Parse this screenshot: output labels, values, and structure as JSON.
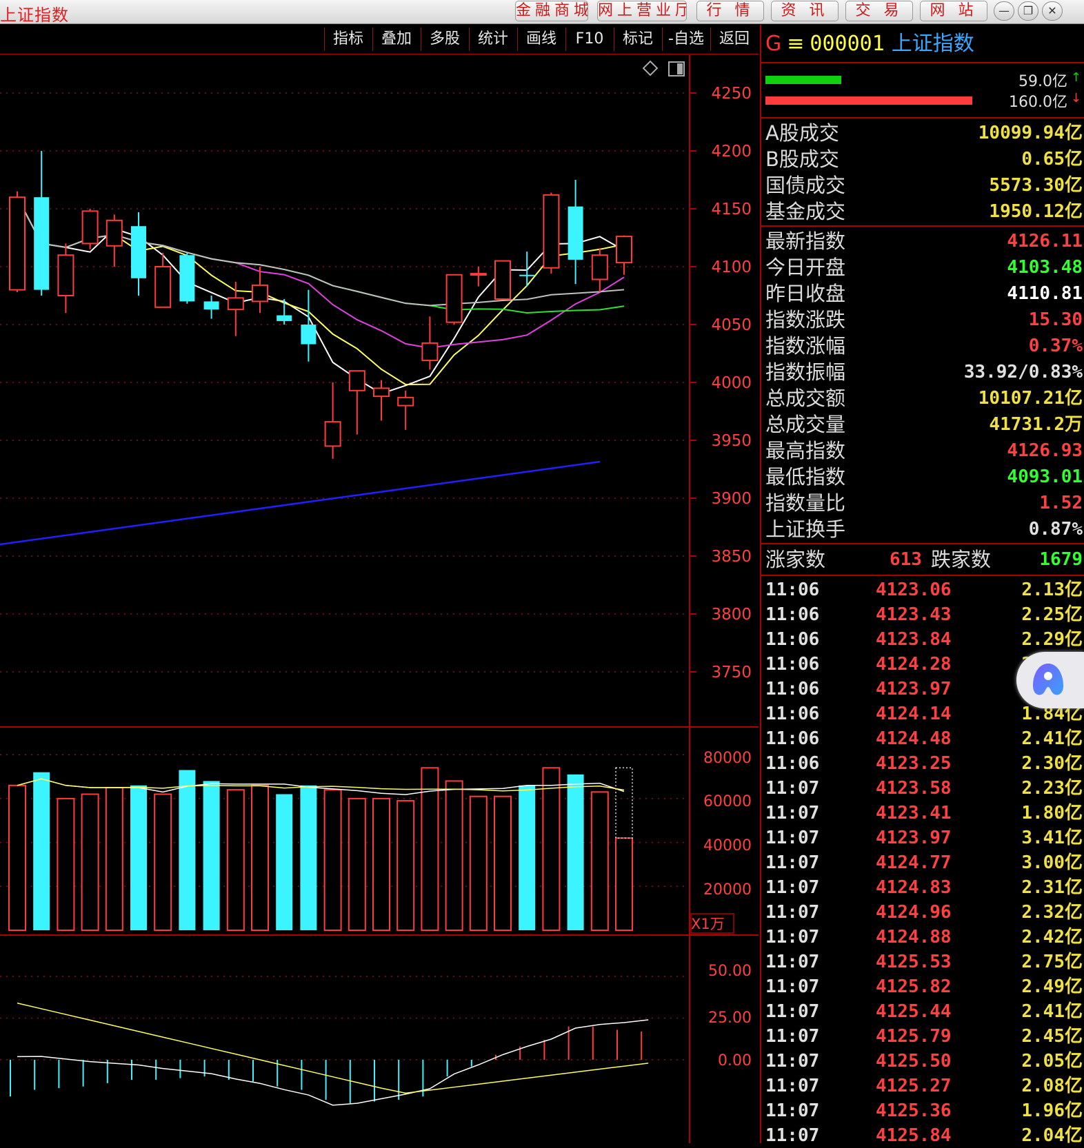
{
  "window": {
    "title": "上证指数",
    "nav": [
      "金融商城",
      "网上营业厅",
      "行 情",
      "资 讯",
      "交 易",
      "网 站"
    ],
    "controls": [
      "—",
      "❐",
      "✕"
    ]
  },
  "toolbar": {
    "items": [
      "指标",
      "叠加",
      "多股",
      "统计",
      "画线",
      "F10",
      "标记",
      "-自选",
      "返回"
    ]
  },
  "colors": {
    "up": "#ff3b3b",
    "down": "#3cf4ff",
    "ma5": "#ffffff",
    "ma10": "#ffff60",
    "ma20": "#e040e0",
    "ma30": "#30e030",
    "ma60": "#c0c0c0",
    "trend": "#2020ff"
  },
  "price_axis": {
    "labels": [
      "4250",
      "4200",
      "4150",
      "4100",
      "4050",
      "4000",
      "3950",
      "3900",
      "3850",
      "3800",
      "3750"
    ]
  },
  "volume_axis": {
    "labels": [
      "80000",
      "60000",
      "40000",
      "20000"
    ],
    "unit": "X1万"
  },
  "macd_axis": {
    "labels": [
      "50.00",
      "25.00",
      "0.00"
    ]
  },
  "chart_data": {
    "type": "candlestick",
    "candles": [
      {
        "open": 4080,
        "close": 4160,
        "high": 4165,
        "low": 4078
      },
      {
        "open": 4160,
        "close": 4080,
        "high": 4200,
        "low": 4075
      },
      {
        "open": 4075,
        "close": 4110,
        "high": 4120,
        "low": 4060
      },
      {
        "open": 4120,
        "close": 4148,
        "high": 4150,
        "low": 4115
      },
      {
        "open": 4118,
        "close": 4140,
        "high": 4145,
        "low": 4100
      },
      {
        "open": 4135,
        "close": 4090,
        "high": 4147,
        "low": 4075
      },
      {
        "open": 4065,
        "close": 4100,
        "high": 4112,
        "low": 4065
      },
      {
        "open": 4110,
        "close": 4070,
        "high": 4112,
        "low": 4068
      },
      {
        "open": 4070,
        "close": 4063,
        "high": 4075,
        "low": 4055
      },
      {
        "open": 4063,
        "close": 4073,
        "high": 4087,
        "low": 4040
      },
      {
        "open": 4070,
        "close": 4084,
        "high": 4100,
        "low": 4060
      },
      {
        "open": 4058,
        "close": 4053,
        "high": 4072,
        "low": 4050
      },
      {
        "open": 4050,
        "close": 4033,
        "high": 4080,
        "low": 4018
      },
      {
        "open": 3945,
        "close": 3966,
        "high": 4000,
        "low": 3934
      },
      {
        "open": 3993,
        "close": 4010,
        "high": 4010,
        "low": 3955
      },
      {
        "open": 3988,
        "close": 3995,
        "high": 4002,
        "low": 3967
      },
      {
        "open": 3980,
        "close": 3987,
        "high": 3993,
        "low": 3959
      },
      {
        "open": 4019,
        "close": 4034,
        "high": 4057,
        "low": 4011
      },
      {
        "open": 4052,
        "close": 4093,
        "high": 4093,
        "low": 4050
      },
      {
        "open": 4093,
        "close": 4094,
        "high": 4100,
        "low": 4083
      },
      {
        "open": 4072,
        "close": 4105,
        "high": 4105,
        "low": 4072
      },
      {
        "open": 4093,
        "close": 4092,
        "high": 4113,
        "low": 4083
      },
      {
        "open": 4099,
        "close": 4162,
        "high": 4164,
        "low": 4094
      },
      {
        "open": 4152,
        "close": 4106,
        "high": 4175,
        "low": 4085
      },
      {
        "open": 4089,
        "close": 4110,
        "high": 4116,
        "low": 4078
      },
      {
        "open": 4103.48,
        "close": 4126.11,
        "high": 4126.93,
        "low": 4093.01
      }
    ],
    "volume": [
      66000,
      72000,
      60000,
      62000,
      65000,
      66000,
      62000,
      73000,
      68000,
      64000,
      66000,
      62000,
      66000,
      64000,
      60000,
      60000,
      59000,
      74000,
      68000,
      61000,
      61000,
      66000,
      74000,
      71000,
      63000,
      42000
    ],
    "volume_forecast": 74000,
    "macd": [
      -22,
      -18,
      -17,
      -16,
      -14,
      -12,
      -12,
      -11,
      -10,
      -12,
      -13,
      -16,
      -18,
      -24,
      -26,
      -25,
      -24,
      -22,
      -10,
      -4,
      3,
      8,
      12,
      20,
      20,
      18,
      17
    ]
  },
  "quote": {
    "market_flag": "G",
    "menu_icon": "≡",
    "code": "000001",
    "name": "上证指数",
    "buy_amount": "59.0亿",
    "sell_amount": "160.0亿",
    "buy_ratio": 0.27,
    "sell_ratio": 0.73,
    "turnover_rows": [
      {
        "label": "A股成交",
        "value": "10099.94亿",
        "color": "#f0e040"
      },
      {
        "label": "B股成交",
        "value": "0.65亿",
        "color": "#f0e040"
      },
      {
        "label": "国债成交",
        "value": "5573.30亿",
        "color": "#f0e040"
      },
      {
        "label": "基金成交",
        "value": "1950.12亿",
        "color": "#f0e040"
      }
    ],
    "stat_rows": [
      {
        "label": "最新指数",
        "value": "4126.11",
        "color": "#ff4040"
      },
      {
        "label": "今日开盘",
        "value": "4103.48",
        "color": "#30ff30"
      },
      {
        "label": "昨日收盘",
        "value": "4110.81",
        "color": "#ffffff"
      },
      {
        "label": "指数涨跌",
        "value": "15.30",
        "color": "#ff4040"
      },
      {
        "label": "指数涨幅",
        "value": "0.37%",
        "color": "#ff4040"
      },
      {
        "label": "指数振幅",
        "value": "33.92/0.83%",
        "color": "#e0e0e0"
      },
      {
        "label": "总成交额",
        "value": "10107.21亿",
        "color": "#f0e040"
      },
      {
        "label": "总成交量",
        "value": "41731.2万",
        "color": "#f0e040"
      },
      {
        "label": "最高指数",
        "value": "4126.93",
        "color": "#ff4040"
      },
      {
        "label": "最低指数",
        "value": "4093.01",
        "color": "#30ff30"
      },
      {
        "label": "指数量比",
        "value": "1.52",
        "color": "#ff4040"
      },
      {
        "label": "上证换手",
        "value": "0.87%",
        "color": "#e0e0e0"
      }
    ],
    "breadth": {
      "up_label": "涨家数",
      "up_count": "613",
      "down_label": "跌家数",
      "down_count": "1679"
    }
  },
  "ticks": [
    {
      "time": "11:06",
      "price": "4123.06",
      "amount": "2.13亿"
    },
    {
      "time": "11:06",
      "price": "4123.43",
      "amount": "2.25亿"
    },
    {
      "time": "11:06",
      "price": "4123.84",
      "amount": "2.29亿"
    },
    {
      "time": "11:06",
      "price": "4124.28",
      "amount": "2.09亿"
    },
    {
      "time": "11:06",
      "price": "4123.97",
      "amount": "1.93亿"
    },
    {
      "time": "11:06",
      "price": "4124.14",
      "amount": "1.84亿"
    },
    {
      "time": "11:06",
      "price": "4124.48",
      "amount": "2.41亿"
    },
    {
      "time": "11:06",
      "price": "4123.25",
      "amount": "2.30亿"
    },
    {
      "time": "11:07",
      "price": "4123.58",
      "amount": "2.23亿"
    },
    {
      "time": "11:07",
      "price": "4123.41",
      "amount": "1.80亿"
    },
    {
      "time": "11:07",
      "price": "4123.97",
      "amount": "3.41亿"
    },
    {
      "time": "11:07",
      "price": "4124.77",
      "amount": "3.00亿"
    },
    {
      "time": "11:07",
      "price": "4124.83",
      "amount": "2.31亿"
    },
    {
      "time": "11:07",
      "price": "4124.96",
      "amount": "2.32亿"
    },
    {
      "time": "11:07",
      "price": "4124.88",
      "amount": "2.42亿"
    },
    {
      "time": "11:07",
      "price": "4125.53",
      "amount": "2.75亿"
    },
    {
      "time": "11:07",
      "price": "4125.82",
      "amount": "2.49亿"
    },
    {
      "time": "11:07",
      "price": "4125.44",
      "amount": "2.41亿"
    },
    {
      "time": "11:07",
      "price": "4125.79",
      "amount": "2.45亿"
    },
    {
      "time": "11:07",
      "price": "4125.50",
      "amount": "2.05亿"
    },
    {
      "time": "11:07",
      "price": "4125.27",
      "amount": "2.08亿"
    },
    {
      "time": "11:07",
      "price": "4125.36",
      "amount": "1.96亿"
    },
    {
      "time": "11:07",
      "price": "4125.84",
      "amount": "2.04亿"
    }
  ]
}
